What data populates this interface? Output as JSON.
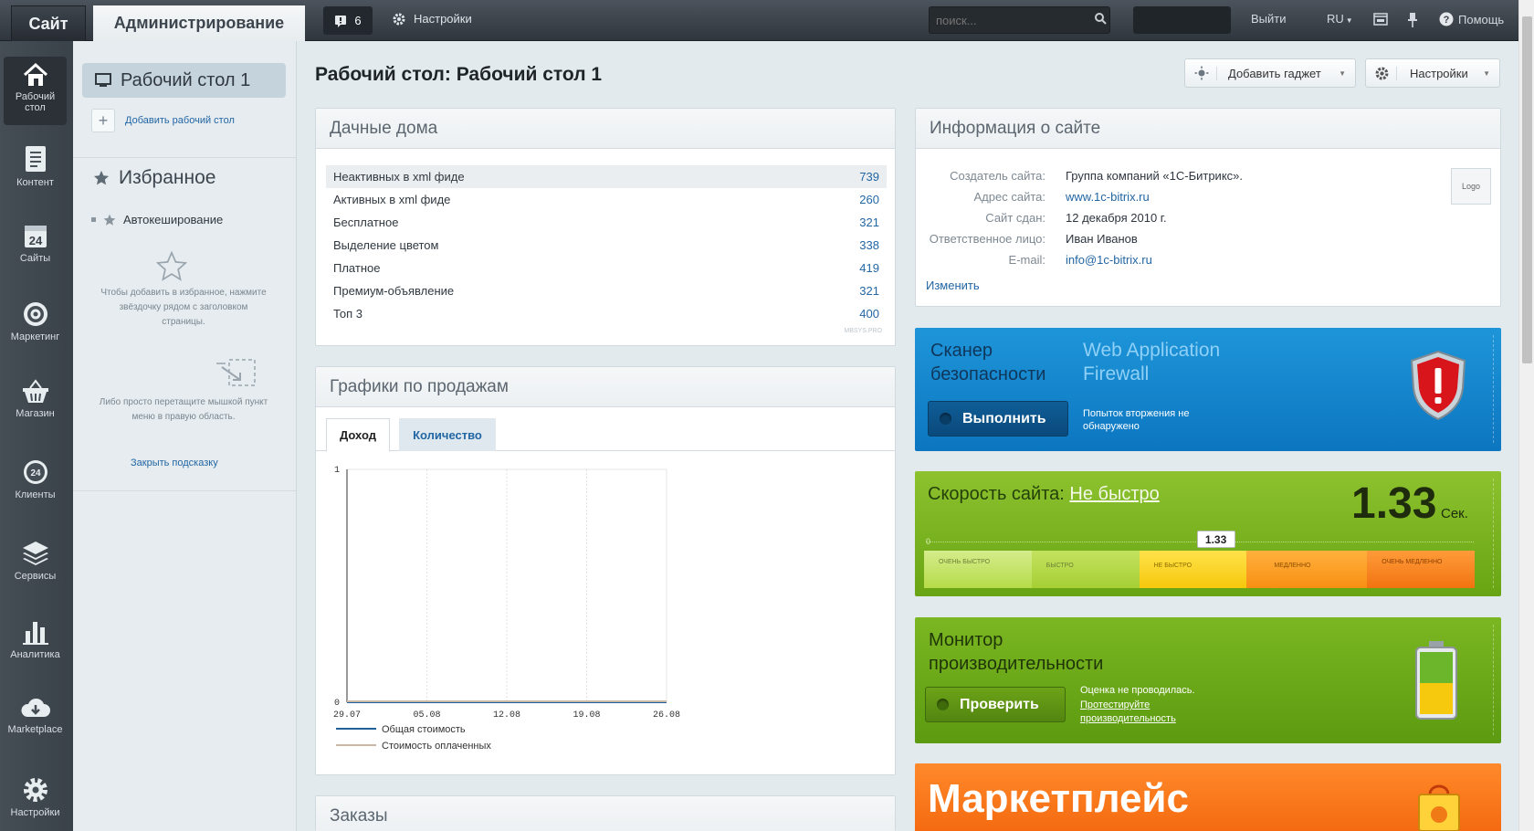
{
  "topbar": {
    "tab_site": "Сайт",
    "tab_admin": "Администрирование",
    "notifications_count": "6",
    "settings": "Настройки",
    "search_placeholder": "поиск...",
    "logout": "Выйти",
    "lang": "RU",
    "help": "Помощь"
  },
  "sidebar": {
    "items": [
      {
        "label": "Рабочий стол",
        "icon": "home-icon"
      },
      {
        "label": "Контент",
        "icon": "document-icon"
      },
      {
        "label": "Сайты",
        "icon": "calendar-icon"
      },
      {
        "label": "Маркетинг",
        "icon": "target-icon"
      },
      {
        "label": "Магазин",
        "icon": "basket-icon"
      },
      {
        "label": "Клиенты",
        "icon": "clock-icon"
      },
      {
        "label": "Сервисы",
        "icon": "layers-icon"
      },
      {
        "label": "Аналитика",
        "icon": "bar-chart-icon"
      },
      {
        "label": "Marketplace",
        "icon": "cloud-download-icon"
      },
      {
        "label": "Настройки",
        "icon": "gear-icon"
      }
    ]
  },
  "left": {
    "desktop": "Рабочий стол 1",
    "add_desktop": "Добавить рабочий стол",
    "favorites": "Избранное",
    "fav_item": "Автокеширование",
    "hint1": "Чтобы добавить в избранное, нажмите звёздочку рядом с заголовком страницы.",
    "hint2": "Либо просто перетащите мышкой пункт меню в правую область.",
    "close_hint": "Закрыть подсказку"
  },
  "main": {
    "title": "Рабочий стол: Рабочий стол 1",
    "add_gadget": "Добавить гаджет",
    "settings": "Настройки"
  },
  "dachnye": {
    "title": "Дачные дома",
    "rows": [
      {
        "label": "Неактивных в xml фиде",
        "value": "739"
      },
      {
        "label": "Активных в xml фиде",
        "value": "260"
      },
      {
        "label": "Бесплатное",
        "value": "321"
      },
      {
        "label": "Выделение цветом",
        "value": "338"
      },
      {
        "label": "Платное",
        "value": "419"
      },
      {
        "label": "Премиум-объявление",
        "value": "321"
      },
      {
        "label": "Топ 3",
        "value": "400"
      }
    ],
    "footnote": "MBSYS.PRO"
  },
  "sales": {
    "title": "Графики по продажам",
    "tab_income": "Доход",
    "tab_quantity": "Количество"
  },
  "chart_data": {
    "type": "line",
    "categories": [
      "29.07",
      "05.08",
      "12.08",
      "19.08",
      "26.08"
    ],
    "series": [
      {
        "name": "Общая стоимость",
        "values": [
          0,
          0,
          0,
          0,
          0
        ],
        "color": "#1f5f9e"
      },
      {
        "name": "Стоимость оплаченных",
        "values": [
          0,
          0,
          0,
          0,
          0
        ],
        "color": "#c9b8a6"
      }
    ],
    "ylim": [
      0,
      1
    ],
    "y_ticks": [
      "0",
      "1"
    ],
    "grid": true,
    "legend": "bottom-left"
  },
  "orders": {
    "title": "Заказы"
  },
  "siteinfo": {
    "title": "Информация о сайте",
    "rows": [
      {
        "label": "Создатель сайта:",
        "value": "Группа компаний «1С-Битрикс»."
      },
      {
        "label": "Адрес сайта:",
        "value": "www.1c-bitrix.ru"
      },
      {
        "label": "Сайт сдан:",
        "value": "12 декабря 2010 г."
      },
      {
        "label": "Ответственное лицо:",
        "value": "Иван Иванов"
      },
      {
        "label": "E-mail:",
        "value": "info@1c-bitrix.ru"
      }
    ],
    "logo": "Logo",
    "edit": "Изменить"
  },
  "scanner": {
    "title": "Сканер безопасности",
    "waf": "Web Application Firewall",
    "run": "Выполнить",
    "status": "Попыток вторжения не обнаружено"
  },
  "speed": {
    "title": "Скорость сайта:",
    "status": "Не быстро",
    "value": "1.33",
    "unit": "Сек.",
    "scale_zero": "0",
    "marker": "1.33",
    "marker_fraction": 0.53,
    "segments": [
      "ОЧЕНЬ БЫСТРО",
      "БЫСТРО",
      "НЕ БЫСТРО",
      "МЕДЛЕННО",
      "ОЧЕНЬ МЕДЛЕННО"
    ]
  },
  "monitor": {
    "title": "Монитор производительности",
    "check": "Проверить",
    "text1": "Оценка не проводилась.",
    "link": "Протестируйте производительность"
  },
  "market": {
    "title": "Маркетплейс"
  }
}
